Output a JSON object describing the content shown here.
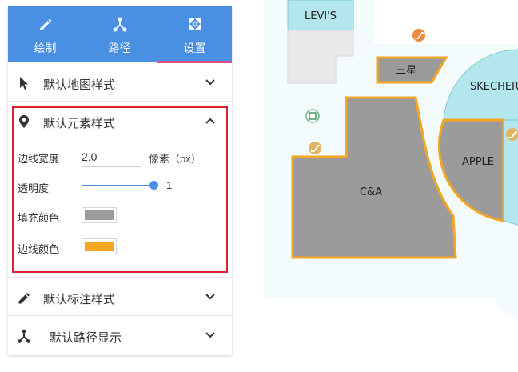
{
  "map": {
    "shops": {
      "levis": "LEVI'S",
      "samsung": "三星",
      "skechers": "SKECHERS",
      "apple": "APPLE",
      "cna": "C&A"
    },
    "colors": {
      "fill_gray": "#9b9b9b",
      "border_orange": "#f5a623",
      "teal": "#b4e6ee",
      "floor": "#f3fbfd",
      "light_gray": "#e9e9e9"
    }
  },
  "panel": {
    "tabs": [
      {
        "label": "绘制",
        "icon": "pencil-icon"
      },
      {
        "label": "路径",
        "icon": "route-icon"
      },
      {
        "label": "设置",
        "icon": "gear-icon"
      }
    ],
    "active_tab": "设置",
    "sections": {
      "map_style": {
        "label": "默认地图样式",
        "icon": "cursor-icon"
      },
      "element_style": {
        "label": "默认元素样式",
        "icon": "location-pin-icon"
      },
      "annotation_style": {
        "label": "默认标注样式",
        "icon": "pencil-icon"
      },
      "route_display": {
        "label": "默认路径显示",
        "icon": "route-icon"
      }
    },
    "element_fields": {
      "border_width_label": "边线宽度",
      "border_width_value": "2.0",
      "border_width_unit": "像素（px）",
      "opacity_label": "透明度",
      "opacity_value": "1",
      "fill_color_label": "填充颜色",
      "fill_color": "#9b9b9b",
      "border_color_label": "边线颜色",
      "border_color": "#f5a623"
    }
  }
}
